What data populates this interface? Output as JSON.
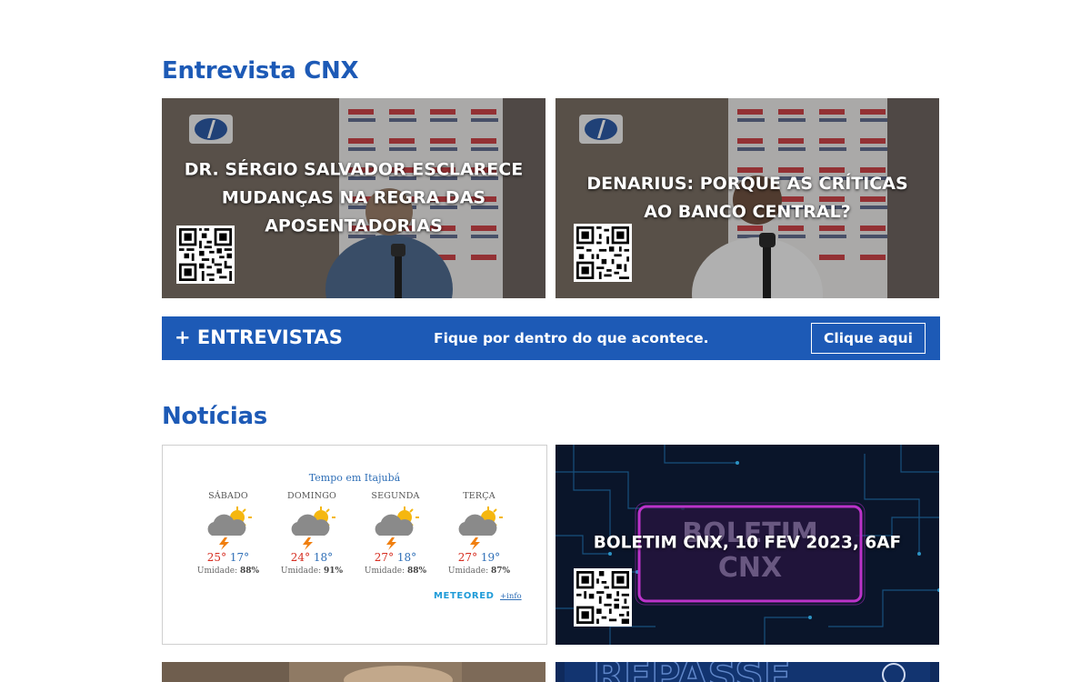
{
  "interviews": {
    "heading": "Entrevista CNX",
    "cards": [
      {
        "title": "DR. SÉRGIO SALVADOR ESCLARECE MUDANÇAS NA REGRA DAS APOSENTADORIAS"
      },
      {
        "title": "DENARIUS: PORQUE AS CRÍTICAS AO BANCO CENTRAL?"
      }
    ],
    "banner": {
      "title": "+ ENTREVISTAS",
      "text": "Fique por dentro do que acontece.",
      "button": "Clique aqui"
    }
  },
  "news": {
    "heading": "Notícias",
    "weather": {
      "title": "Tempo em Itajubá",
      "days": [
        {
          "name": "SÁBADO",
          "max": "25°",
          "min": "17°",
          "humidity_label": "Umidade:",
          "humidity": "88%"
        },
        {
          "name": "DOMINGO",
          "max": "24°",
          "min": "18°",
          "humidity_label": "Umidade:",
          "humidity": "91%"
        },
        {
          "name": "SEGUNDA",
          "max": "27°",
          "min": "18°",
          "humidity_label": "Umidade:",
          "humidity": "88%"
        },
        {
          "name": "TERÇA",
          "max": "27°",
          "min": "19°",
          "humidity_label": "Umidade:",
          "humidity": "87%"
        }
      ],
      "brand": "METEORED",
      "more": "+info"
    },
    "bulletin": {
      "title": "BOLETIM CNX, 10 FEV 2023, 6AF",
      "bg_text_1": "BOLETIM",
      "bg_text_2": "CNX"
    },
    "partial_text": "REPASSE"
  },
  "colors": {
    "accent": "#1d5ab6",
    "temp_max": "#d62d20",
    "temp_min": "#2f6fb7"
  },
  "icons": {
    "weather": "cloud-sun-storm-icon",
    "qr": "qr-code-icon"
  }
}
